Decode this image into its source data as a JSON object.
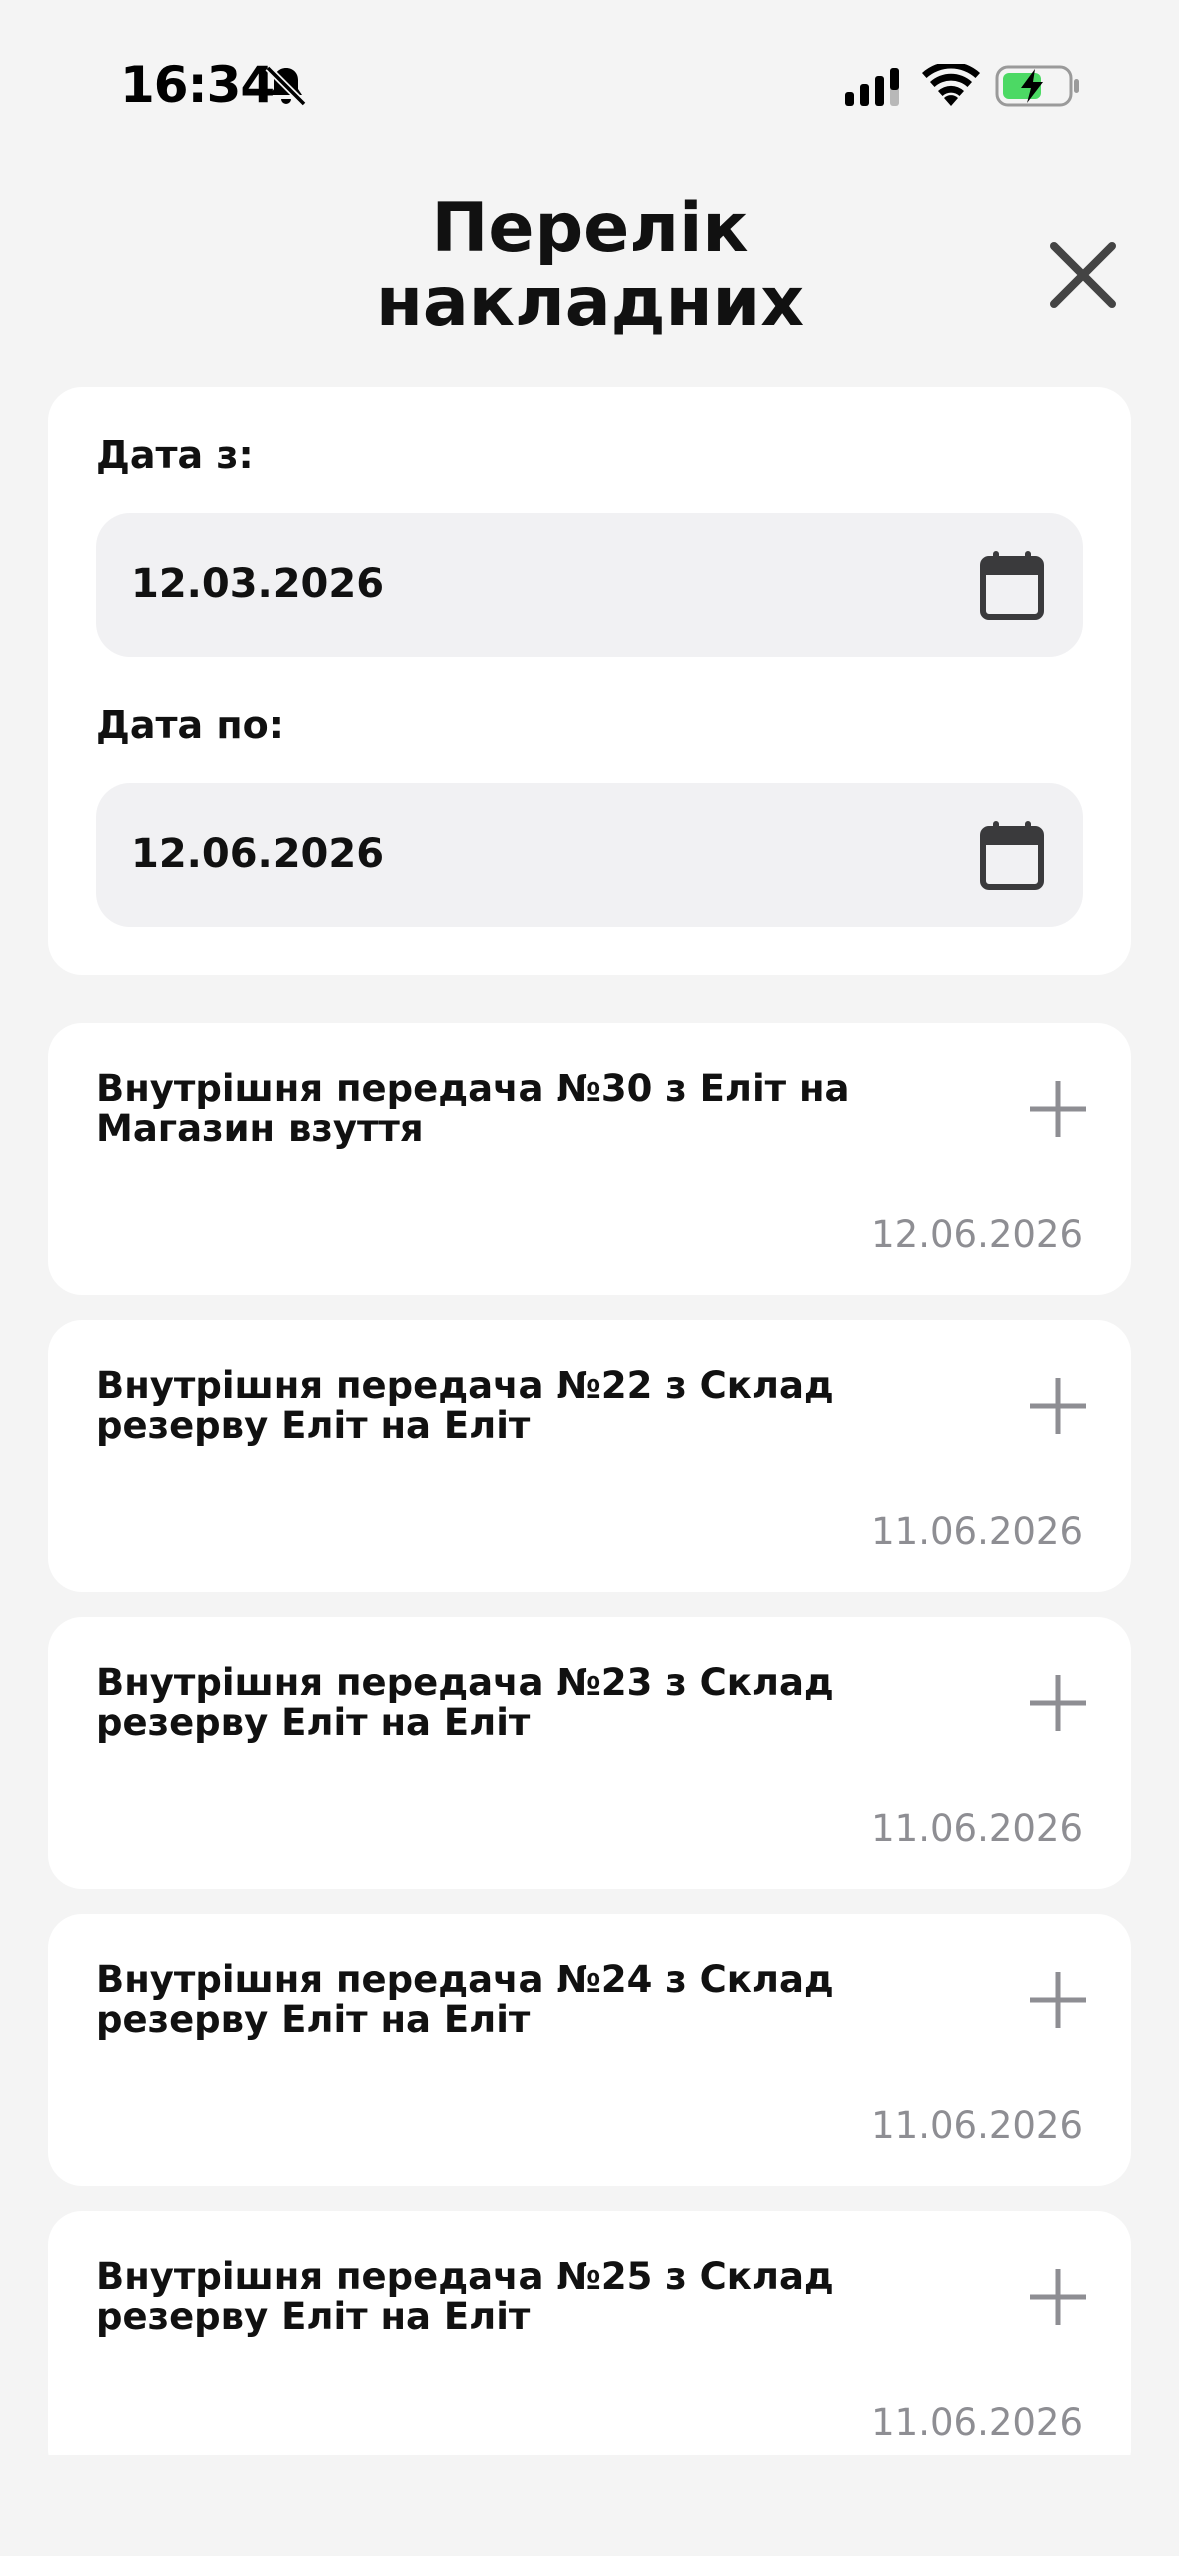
{
  "status_bar": {
    "time": "16:34",
    "icons": [
      "bell-slash-icon",
      "signal-icon",
      "wifi-icon",
      "battery-charging-icon"
    ]
  },
  "header": {
    "title_line1": "Перелік",
    "title_line2": "накладних",
    "close_icon": "close-icon"
  },
  "filters": {
    "date_from_label": "Дата з:",
    "date_from_value": "12.03.2026",
    "date_to_label": "Дата по:",
    "date_to_value": "12.06.2026"
  },
  "invoices": [
    {
      "title_line1": "Внутрішня передача №30 з Еліт на",
      "title_line2": "Магазин взуття",
      "date": "12.06.2026"
    },
    {
      "title_line1": "Внутрішня передача №22 з Склад",
      "title_line2": "резерву Еліт на Еліт",
      "date": "11.06.2026"
    },
    {
      "title_line1": "Внутрішня передача №23 з Склад",
      "title_line2": "резерву Еліт на Еліт",
      "date": "11.06.2026"
    },
    {
      "title_line1": "Внутрішня передача №24 з Склад",
      "title_line2": "резерву Еліт на Еліт",
      "date": "11.06.2026"
    },
    {
      "title_line1": "Внутрішня передача №25 з Склад",
      "title_line2": "резерву Еліт на Еліт",
      "date": "11.06.2026"
    }
  ],
  "colors": {
    "background": "#f4f4f4",
    "card": "#ffffff",
    "field": "#f1f1f3",
    "muted_text": "#8e8e93",
    "battery_fill": "#4cd964"
  }
}
